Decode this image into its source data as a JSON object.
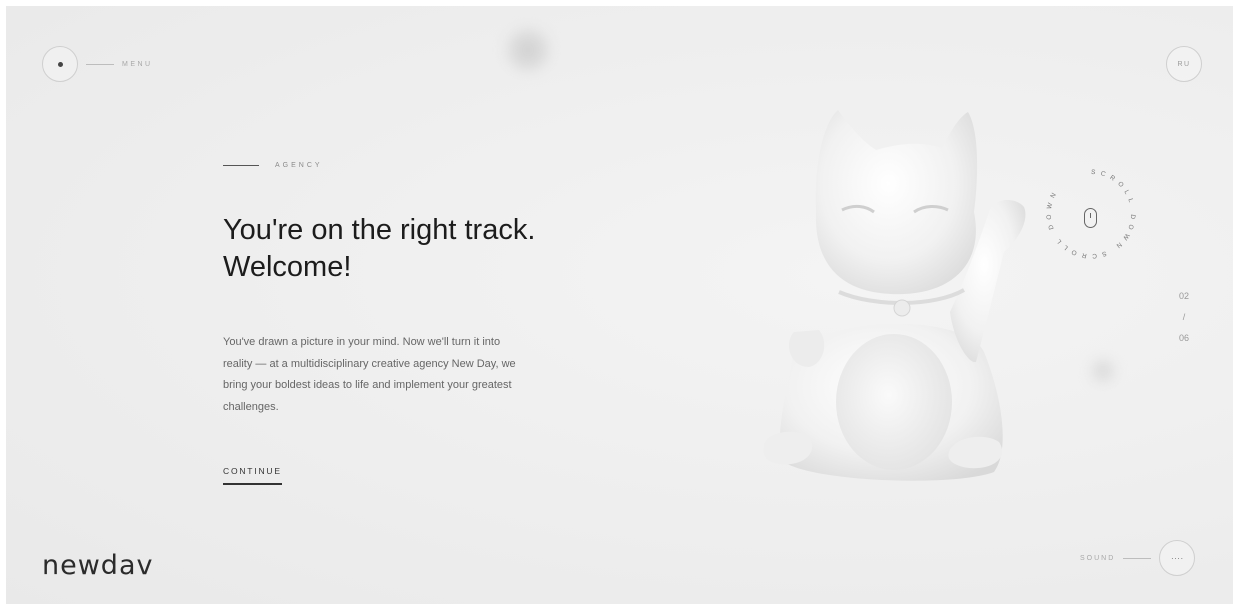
{
  "menu": {
    "label": "MENU"
  },
  "language": {
    "label": "RU"
  },
  "hero": {
    "eyebrow": "AGENCY",
    "headline_line1": "You're on the right track.",
    "headline_line2": "Welcome!",
    "body": "You've drawn a picture in your mind. Now we'll turn it into reality — at a multidisciplinary creative agency New Day, we bring your boldest ideas to life and implement your greatest challenges.",
    "cta": "CONTINUE"
  },
  "scroll_indicator": {
    "ring_text": "SCROLL DOWN SCROLL DOWN"
  },
  "pagination": {
    "current": "02",
    "separator": "/",
    "total": "06"
  },
  "sound": {
    "label": "SOUND",
    "icon_text": "····"
  },
  "brand": {
    "logo": "newdav"
  },
  "colors": {
    "background": "#eeeeee",
    "text_dark": "#1c1c1c",
    "text_muted": "#666666"
  }
}
